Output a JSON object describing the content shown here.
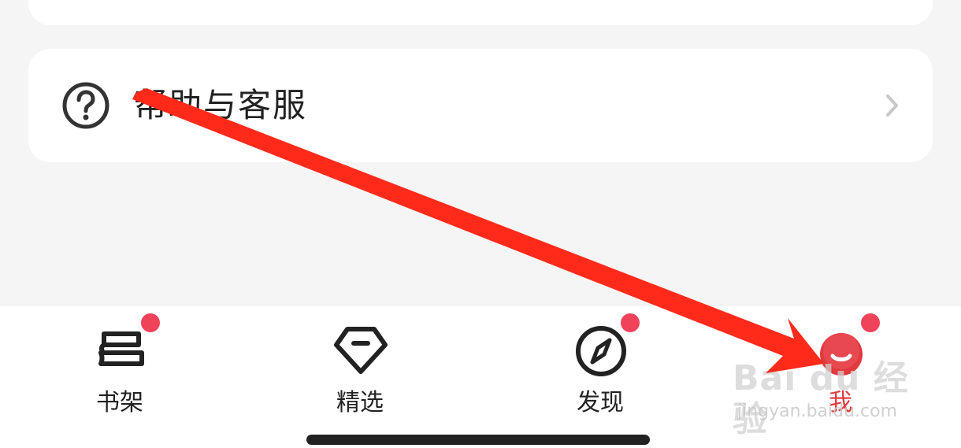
{
  "help_card": {
    "label": "帮助与客服",
    "icon": "question-circle-icon",
    "chevron_icon": "chevron-right-icon"
  },
  "tabbar": {
    "tabs": [
      {
        "label": "书架",
        "icon": "bookshelf-icon",
        "badge": true,
        "active": false
      },
      {
        "label": "精选",
        "icon": "diamond-icon",
        "badge": false,
        "active": false
      },
      {
        "label": "发现",
        "icon": "compass-icon",
        "badge": true,
        "active": false
      },
      {
        "label": "我",
        "icon": "profile-face-icon",
        "badge": true,
        "active": true
      }
    ]
  },
  "colors": {
    "background": "#f5f5f5",
    "card": "#ffffff",
    "accent": "#e03a3e",
    "badge": "#f0435a",
    "annotation_arrow": "#ff2a1a"
  },
  "watermark": {
    "brand": "Bai du 经验",
    "url": "jingyan.baidu.com"
  }
}
